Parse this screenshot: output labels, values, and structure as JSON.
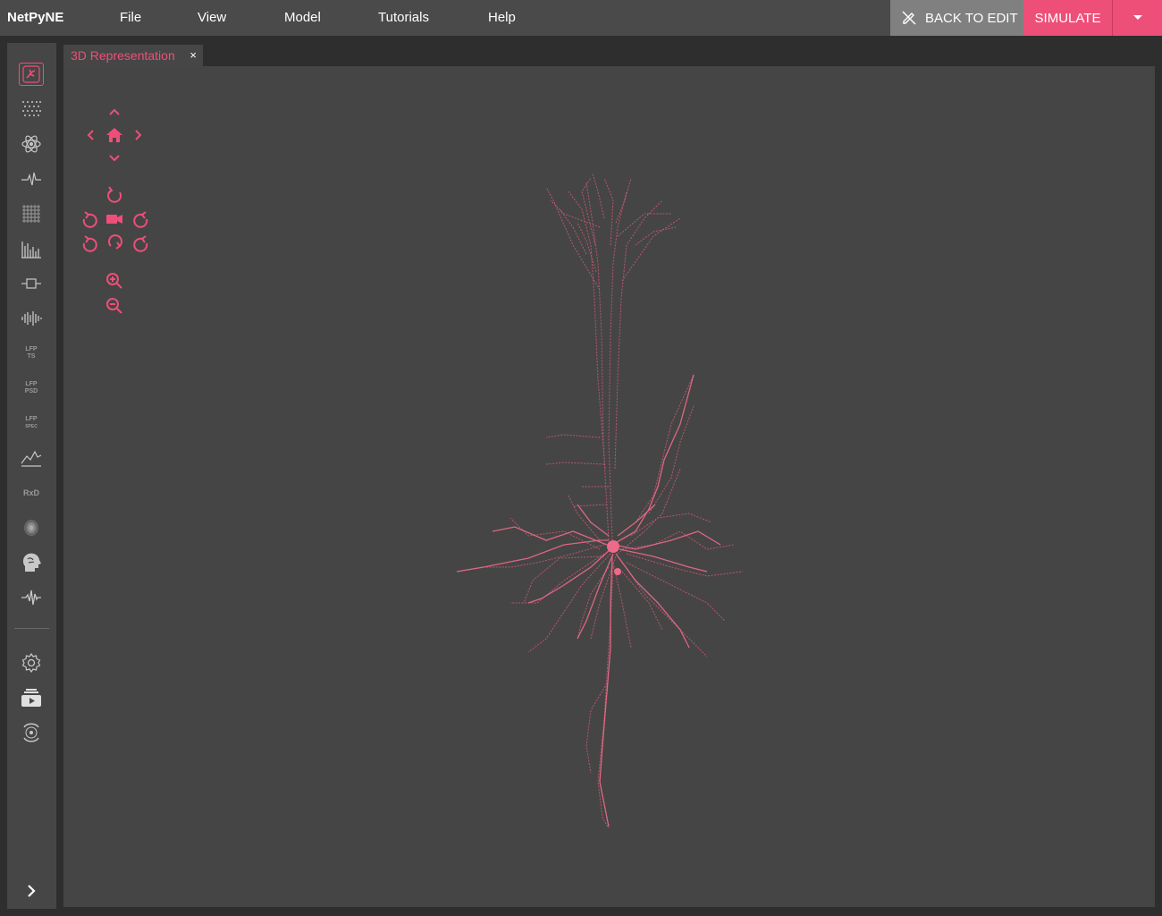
{
  "app": {
    "brand": "NetPyNE"
  },
  "menu": [
    "File",
    "View",
    "Model",
    "Tutorials",
    "Help"
  ],
  "actions": {
    "back_to_edit": "BACK TO EDIT",
    "simulate": "SIMULATE"
  },
  "tabs": [
    {
      "label": "3D Representation",
      "close": "×"
    }
  ],
  "sidebar": {
    "items": [
      "3d-cell-icon",
      "raster-dots-icon",
      "connectivity-atom-icon",
      "trace-icon",
      "grid-icon",
      "histogram-icon",
      "connection-icon",
      "spike-wave-icon",
      "lfp-ts-icon",
      "lfp-psd-icon",
      "lfp-spec-icon",
      "granger-icon",
      "rxd-icon",
      "dipole-icon",
      "brain-head-icon",
      "eeg-wave-icon"
    ],
    "lfp_ts": [
      "LFP",
      "TS"
    ],
    "lfp_psd": [
      "LFP",
      "PSD"
    ],
    "lfp_spec": [
      "LFP",
      "SPEC"
    ],
    "rxd": "RxD",
    "bottom": [
      "settings-gear-icon",
      "tutorials-stack-icon",
      "netpyne-logo-icon"
    ]
  },
  "colors": {
    "accent": "#ee4f79",
    "topbar": "#4a4a4a",
    "canvas": "#454545",
    "back_button": "#808080"
  }
}
